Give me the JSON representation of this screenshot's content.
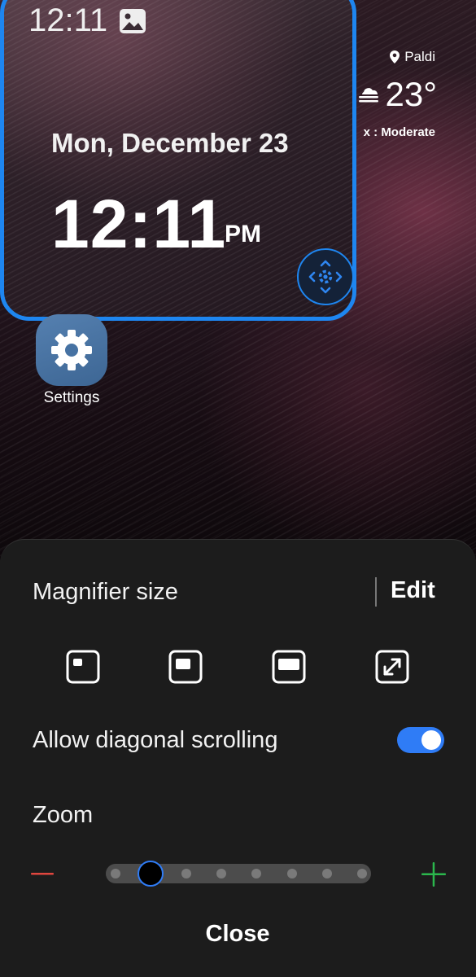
{
  "status_bar": {
    "time": "12:11"
  },
  "weather": {
    "location": "Paldi",
    "temperature": "23°",
    "air_quality": "x : Moderate"
  },
  "lock_clock": {
    "date": "Mon, December 23",
    "time": "12:11",
    "ampm": "PM"
  },
  "home": {
    "app_label": "Settings"
  },
  "sheet": {
    "title": "Magnifier size",
    "edit_label": "Edit",
    "size_options": [
      "small",
      "medium",
      "large",
      "full-screen"
    ],
    "diagonal_label": "Allow diagonal scrolling",
    "diagonal_enabled": true,
    "zoom_label": "Zoom",
    "zoom_level_index": 1,
    "zoom_steps": 8,
    "close_label": "Close"
  },
  "colors": {
    "accent": "#1e86f0",
    "toggle_on": "#2f7cf6",
    "minus": "#e0463e",
    "plus": "#2bb74d"
  }
}
